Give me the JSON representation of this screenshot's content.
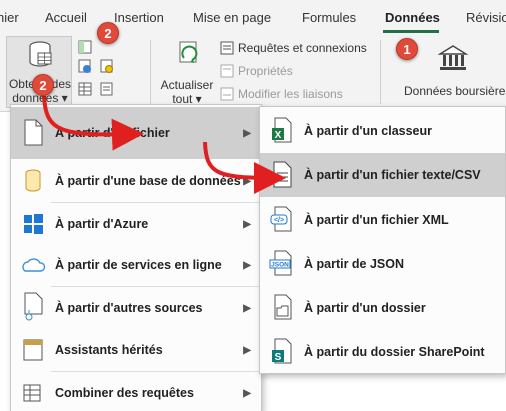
{
  "tabs": [
    {
      "label": "hier",
      "active": false
    },
    {
      "label": "Accueil",
      "active": false
    },
    {
      "label": "Insertion",
      "active": false
    },
    {
      "label": "Mise en page",
      "active": false
    },
    {
      "label": "Formules",
      "active": false
    },
    {
      "label": "Données",
      "active": true
    },
    {
      "label": "Révisio",
      "active": false
    }
  ],
  "ribbon": {
    "get_data": {
      "line1": "Obtenir des",
      "line2": "données ▾"
    },
    "refresh": {
      "line1": "Actualiser",
      "line2": "tout ▾"
    },
    "queries_connections": "Requêtes et connexions",
    "properties": "Propriétés",
    "edit_links": "Modifier les liaisons",
    "stocks": "Données boursières"
  },
  "menu_primary": [
    {
      "label": "À partir d'un fichier",
      "submenu": true,
      "highlighted": true
    },
    {
      "label": "À partir d'une base de données",
      "submenu": true
    },
    {
      "label": "À partir d'Azure",
      "submenu": true
    },
    {
      "label": "À partir de services en ligne",
      "submenu": true
    },
    {
      "label": "À partir d'autres sources",
      "submenu": true
    },
    {
      "label": "Assistants hérités",
      "submenu": true
    },
    {
      "label": "Combiner des requêtes",
      "submenu": true
    }
  ],
  "menu_file": [
    {
      "label": "À partir d'un classeur",
      "icon": "excel-workbook-icon"
    },
    {
      "label": "À partir d'un fichier texte/CSV",
      "icon": "text-csv-icon",
      "highlighted": true
    },
    {
      "label": "À partir d'un fichier XML",
      "icon": "xml-file-icon"
    },
    {
      "label": "À partir de JSON",
      "icon": "json-file-icon"
    },
    {
      "label": "À partir d'un dossier",
      "icon": "folder-icon"
    },
    {
      "label": "À partir du dossier SharePoint",
      "icon": "sharepoint-folder-icon"
    }
  ],
  "badges": {
    "one": "1",
    "two_a": "2",
    "two_b": "2"
  },
  "colors": {
    "accent_green": "#217346",
    "badge_red": "#e04a3a",
    "arrow_red": "#e02020",
    "highlight": "#cfcfcf"
  }
}
